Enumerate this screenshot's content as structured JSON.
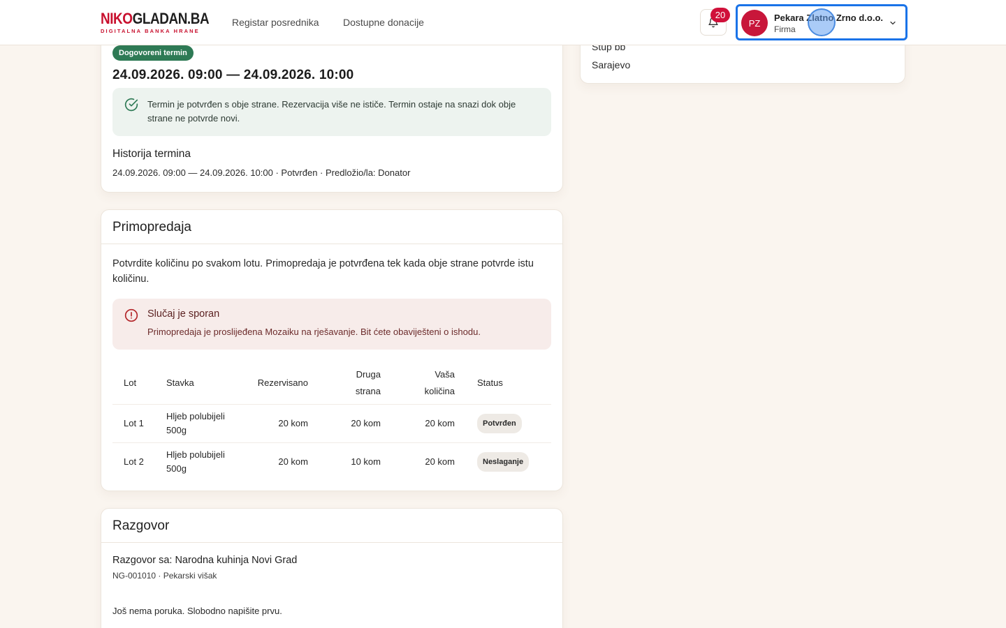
{
  "header": {
    "logo_part1": "NIKO",
    "logo_part2": "GLADAN.BA",
    "logo_tagline": "DIGITALNA BANKA HRANE",
    "nav": [
      {
        "label": "Registar posrednika"
      },
      {
        "label": "Dostupne donacije"
      }
    ],
    "notifications_count": "20",
    "user": {
      "initials": "PZ",
      "name": "Pekara Zlatno Zrno d.o.o.",
      "role": "Firma"
    }
  },
  "address_card": {
    "street": "Stup bb",
    "city": "Sarajevo"
  },
  "term_card": {
    "status_pill": "Dogovoreni termin",
    "title": "24.09.2026. 09:00 — 24.09.2026. 10:00",
    "notice": "Termin je potvrđen s obje strane. Rezervacija više ne ističe. Termin ostaje na snazi dok obje strane ne potvrde novi.",
    "history_title": "Historija termina",
    "history_entry": "24.09.2026. 09:00 — 24.09.2026. 10:00 · Potvrđen · Predložio/la: Donator"
  },
  "handover_card": {
    "title": "Primopredaja",
    "intro": "Potvrdite količinu po svakom lotu. Primopredaja je potvrđena tek kada obje strane potvrde istu količinu.",
    "alert_title": "Slučaj je sporan",
    "alert_text": "Primopredaja je proslijeđena Mozaiku na rješavanje. Bit ćete obaviješteni o ishodu.",
    "columns": {
      "lot": "Lot",
      "item": "Stavka",
      "reserved": "Rezervisano",
      "other_party": "Druga strana",
      "yours": "Vaša količina",
      "status": "Status"
    },
    "rows": [
      {
        "lot": "Lot 1",
        "item": "Hljeb polubijeli 500g",
        "reserved": "20 kom",
        "other_party": "20 kom",
        "yours": "20 kom",
        "status": "Potvrđen"
      },
      {
        "lot": "Lot 2",
        "item": "Hljeb polubijeli 500g",
        "reserved": "20 kom",
        "other_party": "10 kom",
        "yours": "20 kom",
        "status": "Neslaganje"
      }
    ]
  },
  "conversation_card": {
    "title": "Razgovor",
    "with": "Razgovor sa: Narodna kuhinja Novi Grad",
    "meta": "NG-001010 · Pekarski višak",
    "empty": "Još nema poruka. Slobodno napišite prvu."
  },
  "colors": {
    "brand_red": "#c8102e",
    "accent_green": "#2e7a55",
    "focus_blue": "#1a73e8",
    "page_bg": "#faf5ef"
  }
}
